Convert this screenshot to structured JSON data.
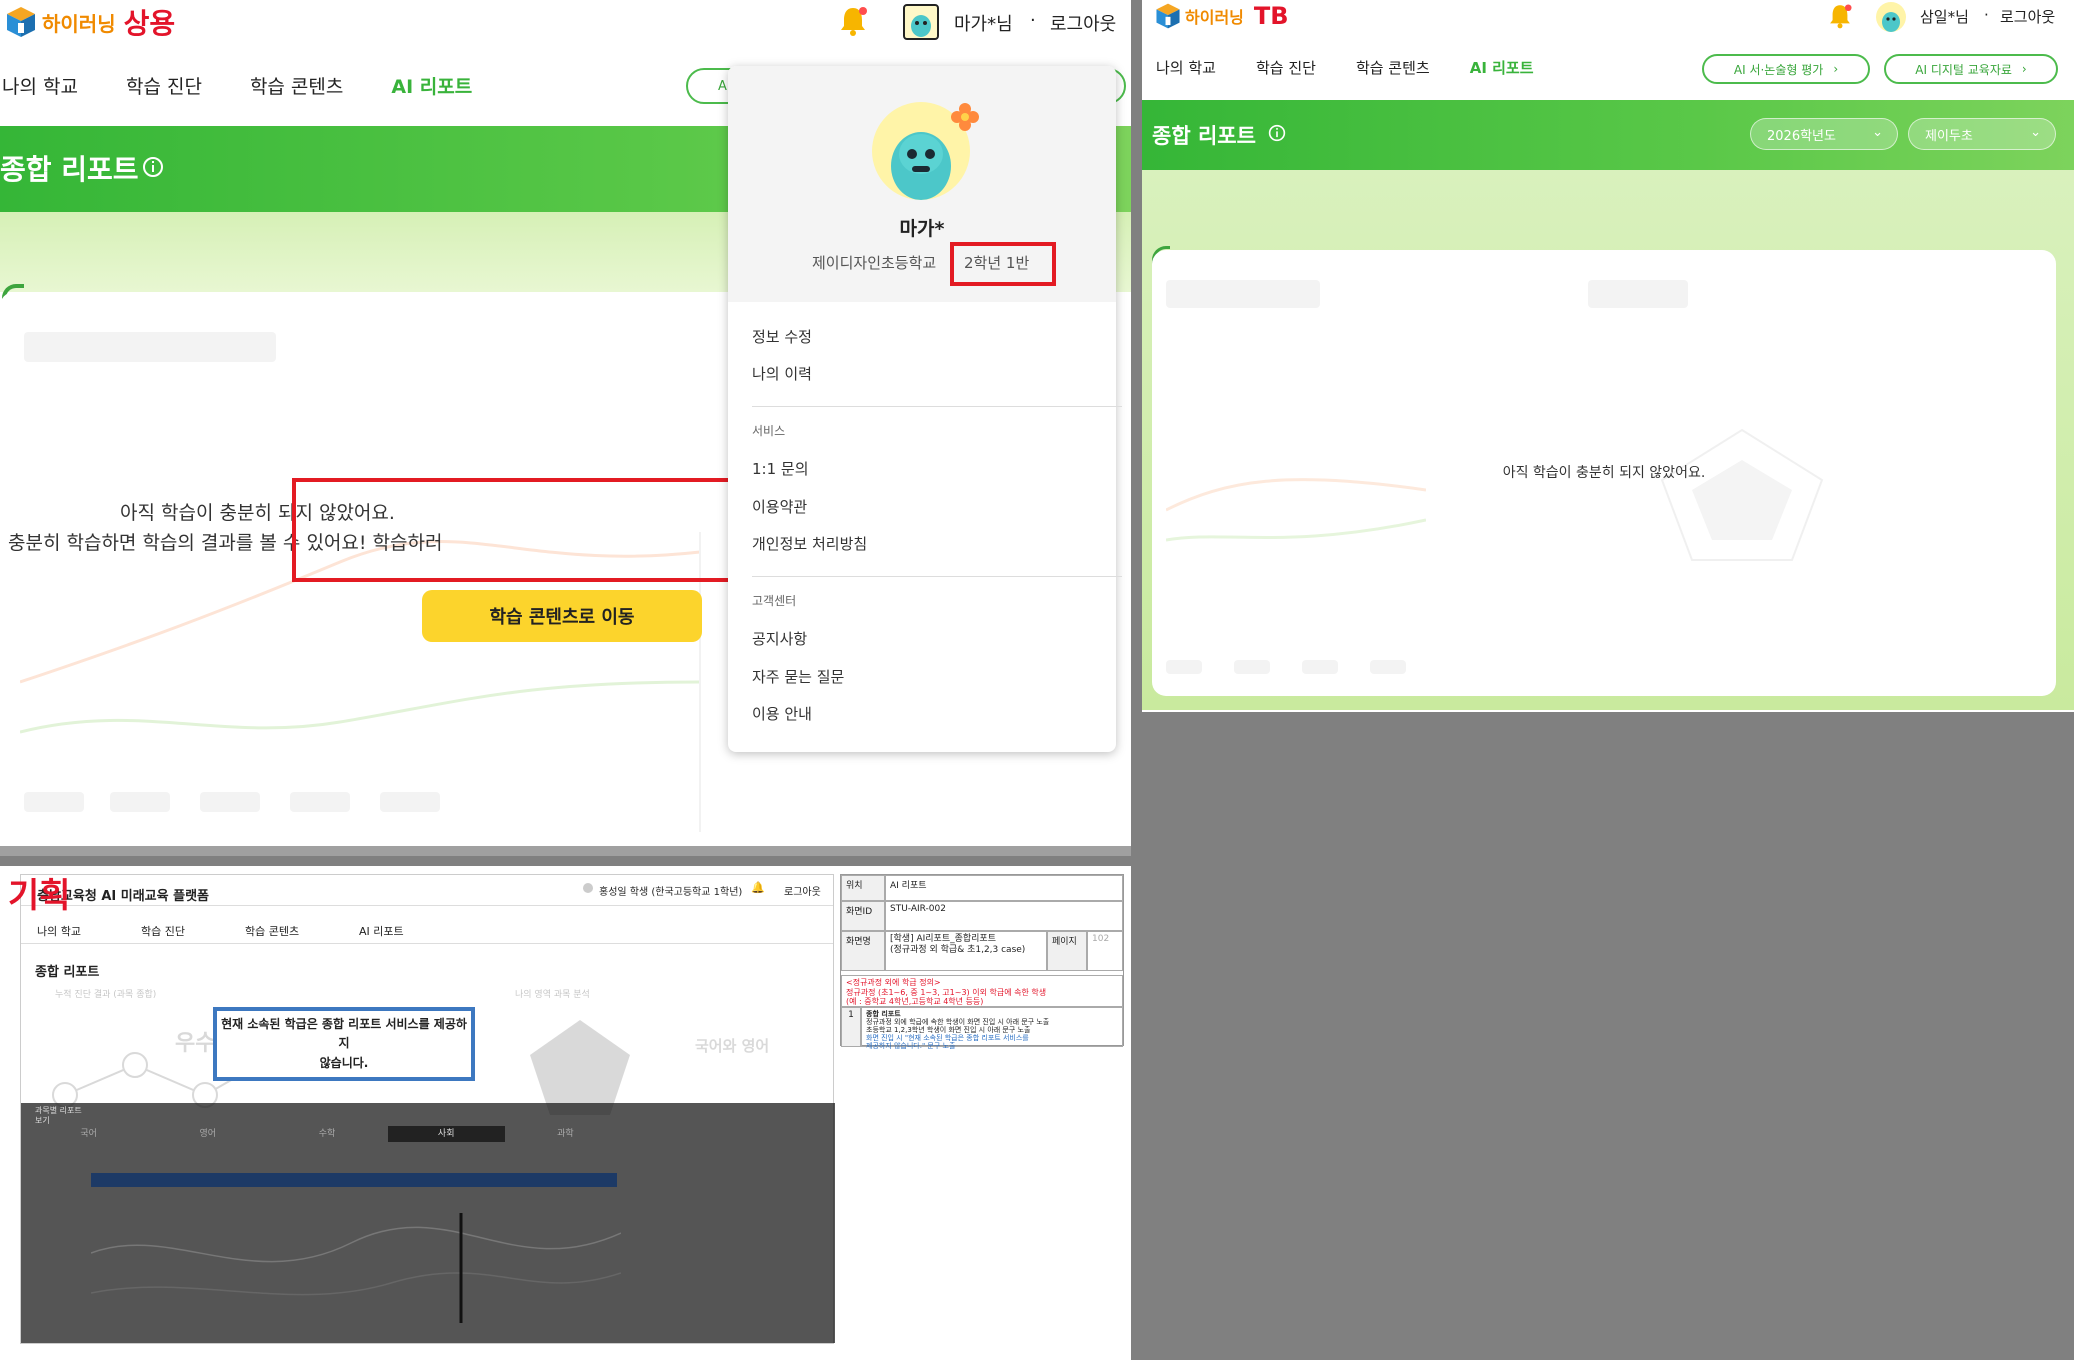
{
  "panel_a": {
    "logo_text": "하이러닝",
    "env_label": "상용",
    "user_label": "마가*님",
    "separator": "·",
    "logout": "로그아웃",
    "nav": [
      "나의 학교",
      "학습 진단",
      "학습 콘텐츠",
      "AI 리포트"
    ],
    "active_nav": "AI 리포트",
    "pill_partial": "A",
    "page_title": "종합 리포트",
    "info_icon": "info-circle-icon",
    "message_line1": "아직 학습이 충분히 되지 않았어요.",
    "message_line2": "충분히 학습하면 학습의 결과를 볼 수 있어요! 학습하러",
    "cta_button": "학습 콘텐츠로 이동",
    "dropdown": {
      "name": "마가*",
      "school": "제이디자인초등학교",
      "grade_class": "2학년 1반",
      "items_account": [
        "정보 수정",
        "나의 이력"
      ],
      "section_service": "서비스",
      "items_service": [
        "1:1 문의",
        "이용약관",
        "개인정보 처리방침"
      ],
      "section_support": "고객센터",
      "items_support": [
        "공지사항",
        "자주 묻는 질문",
        "이용 안내"
      ]
    }
  },
  "panel_b": {
    "logo_text": "하이러닝",
    "env_label": "TB",
    "user_label": "삼일*님",
    "separator": "·",
    "logout": "로그아웃",
    "nav": [
      "나의 학교",
      "학습 진단",
      "학습 콘텐츠",
      "AI 리포트"
    ],
    "active_nav": "AI 리포트",
    "pill_buttons": [
      "AI 서·논술형 평가",
      "AI 디지털 교육자료"
    ],
    "page_title": "종합 리포트",
    "year_select": "2026학년도",
    "school_select": "제이두초",
    "message": "아직 학습이 충분히 되지 않았어요."
  },
  "panel_c": {
    "label": "기획",
    "platform_title": "충남교육청 AI 미래교육 플랫폼",
    "user_info": "홍성일 학생 (한국고등학교 1학년)",
    "logout": "로그아웃",
    "nav": [
      "나의 학교",
      "학습 진단",
      "학습 콘텐츠",
      "AI 리포트"
    ],
    "page_title": "종합 리포트",
    "notice_line1": "현재 소속된 학급은 종합 리포트 서비스를 제공하지",
    "notice_line2": "않습니다.",
    "chart_left_label": "누적 진단 결과 (과목 종합)",
    "chart_right_label": "나의 영역 과목 분석",
    "grade_word": "우수",
    "subject_text": "국어와 영어",
    "subject_tabs": [
      "국어",
      "영어",
      "수학",
      "사회",
      "과학"
    ],
    "side_label_1": "과목별 리포트",
    "side_label_2": "보기",
    "spec": {
      "loc_label": "위치",
      "loc_value": "AI 리포트",
      "id_label": "화면ID",
      "id_value": "STU-AIR-002",
      "name_label": "화면명",
      "name_value": "[학생] AI리포트_종합리포트",
      "name_sub": "(정규과정 외 학급& 초1,2,3 case)",
      "page_label": "페이지",
      "page_no": "102",
      "def_title": "<정규과정 외에 학급 정의>",
      "def_line1": "정규과정 (초1~6, 중 1~3, 고1~3) 이외 학급에 속한 학생",
      "def_line2": "(예 : 중학교 4학년,고등학교 4학년 등등)",
      "row_no": "1",
      "desc_title": "종합 리포트",
      "desc_line1": "정규과정 외에 학급에 속한 학생이 화면 진입 시 아래 문구 노출",
      "desc_line2": "초등학교 1,2,3학년 학생이 화면 진입 시 아래 문구 노출",
      "desc_line3": "화면 진입 시 \"현재 소속된 학급은 종합 리포트 서비스를",
      "desc_line4": "제공하지 않습니다.\" 문구 노출"
    }
  },
  "colors": {
    "brand_green": "#39b33b",
    "brand_orange": "#f08a00",
    "alert_red": "#e3142a",
    "cta_yellow": "#fcd42c",
    "spec_blue": "#3d78c0"
  }
}
